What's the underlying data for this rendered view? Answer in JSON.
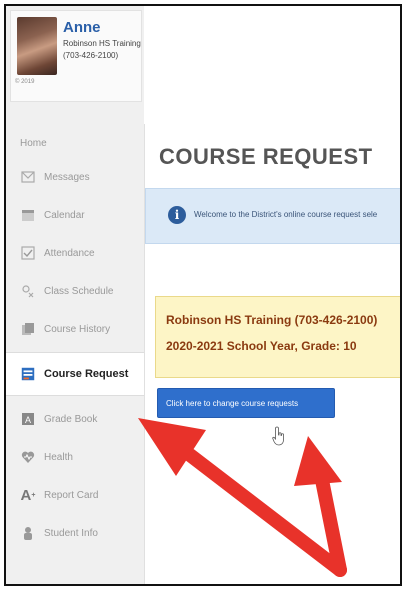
{
  "profile": {
    "name": "Anne",
    "school": "Robinson HS Training",
    "phone": "(703-426-2100)",
    "avatar_caption": "© 2019"
  },
  "nav": {
    "home": "Home",
    "items": [
      {
        "label": "Messages",
        "icon": "envelope-icon"
      },
      {
        "label": "Calendar",
        "icon": "calendar-icon"
      },
      {
        "label": "Attendance",
        "icon": "checklist-icon"
      },
      {
        "label": "Class Schedule",
        "icon": "schedule-icon"
      },
      {
        "label": "Course History",
        "icon": "history-icon"
      },
      {
        "label": "Course Request",
        "icon": "course-request-icon",
        "active": true
      },
      {
        "label": "Grade Book",
        "icon": "gradebook-icon"
      },
      {
        "label": "Health",
        "icon": "health-icon"
      },
      {
        "label": "Report Card",
        "icon": "report-card-icon"
      },
      {
        "label": "Student Info",
        "icon": "student-icon"
      }
    ]
  },
  "main": {
    "title": "COURSE REQUEST",
    "info_text": "Welcome to the District's online course request sele",
    "school_line1": "Robinson HS Training (703-426-2100)",
    "school_line2": "2020-2021 School Year, Grade: 10",
    "change_button": "Click here to change course requests"
  },
  "colors": {
    "accent": "#2f6fcc",
    "banner": "#dbe9f7",
    "notice": "#fdf5c6",
    "arrow": "#e8322a"
  }
}
